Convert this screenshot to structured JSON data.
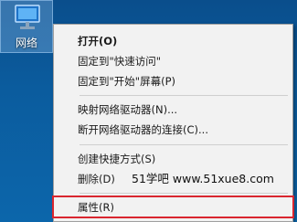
{
  "desktop": {
    "icon": {
      "label": "网络",
      "icon_name": "network-icon"
    }
  },
  "context_menu": {
    "items": [
      {
        "label": "打开(O)",
        "bold": true
      },
      {
        "label": "固定到\"快速访问\""
      },
      {
        "label": "固定到\"开始\"屏幕(P)"
      },
      {
        "label": "映射网络驱动器(N)..."
      },
      {
        "label": "断开网络驱动器的连接(C)..."
      },
      {
        "label": "创建快捷方式(S)"
      },
      {
        "label": "删除(D)"
      },
      {
        "label": "属性(R)",
        "highlighted": true
      }
    ]
  },
  "watermark": "51学吧 www.51xue8.com",
  "colors": {
    "highlight_border": "#d9262f",
    "menu_background": "#f2f2f2",
    "desktop_background": "#0b5c9e"
  }
}
